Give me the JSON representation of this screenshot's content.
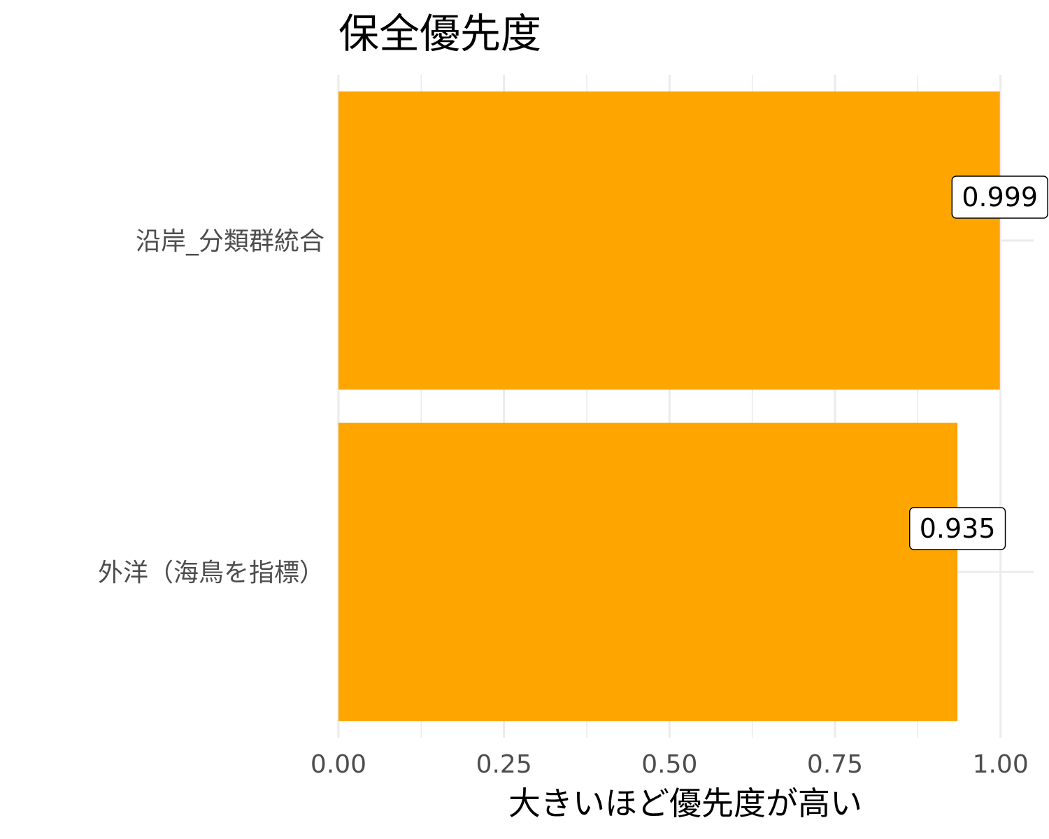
{
  "chart_data": {
    "type": "bar",
    "orientation": "horizontal",
    "title": "保全優先度",
    "xlabel": "大きいほど優先度が高い",
    "ylabel": "",
    "categories": [
      "沿岸_分類群統合",
      "外洋（海鳥を指標）"
    ],
    "values": [
      0.999,
      0.935
    ],
    "data_labels": [
      "0.999",
      "0.935"
    ],
    "xlim": [
      0,
      1.05
    ],
    "x_ticks": [
      0,
      0.25,
      0.5,
      0.75,
      1.0
    ],
    "x_tick_labels": [
      "0.00",
      "0.25",
      "0.50",
      "0.75",
      "1.00"
    ],
    "grid": true,
    "bar_color": "#FFA500",
    "grid_color": "#EBEBEB"
  }
}
